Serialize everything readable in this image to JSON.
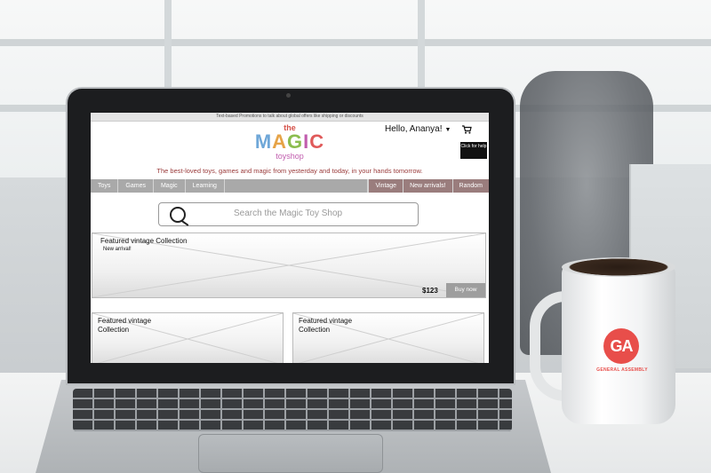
{
  "promo": {
    "text": "Text-based Promotions to talk about global offers like shipping or discounts"
  },
  "logo": {
    "the": "the",
    "magic": [
      "M",
      "A",
      "G",
      "I",
      "C"
    ],
    "toyshop": "toyshop"
  },
  "header": {
    "greeting": "Hello, Ananya!",
    "caret": "▼",
    "cart_icon": "shopping-cart",
    "help_label": "Click for help"
  },
  "tagline": "The best-loved toys, games and magic from yesterday and today, in your hands tomorrow.",
  "nav": {
    "left": [
      "Toys",
      "Games",
      "Magic",
      "Learning"
    ],
    "right": [
      "Vintage",
      "New arrivals!",
      "Random"
    ]
  },
  "search": {
    "placeholder": "Search the Magic Toy Shop",
    "icon": "magnifier"
  },
  "featured": {
    "title": "Featured vintage Collection",
    "subtitle": "New arrival!",
    "price": "$123",
    "buy_label": "Buy now"
  },
  "cards": [
    {
      "title": "Featured vintage Collection"
    },
    {
      "title": "Featured vintage Collection"
    }
  ],
  "mug": {
    "logo": "GA",
    "text": "GENERAL ASSEMBLY",
    "color": "#e84e4a"
  }
}
